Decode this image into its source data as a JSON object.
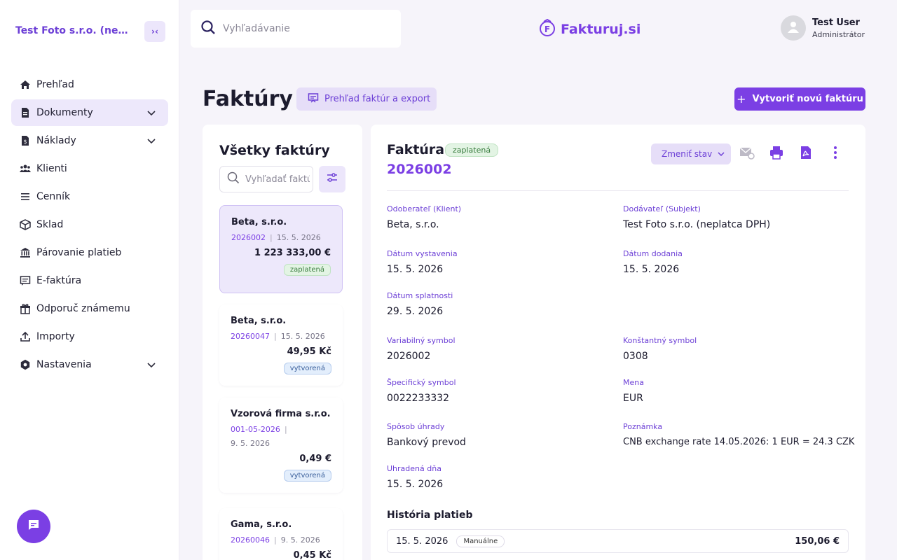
{
  "sidebar": {
    "company": "Test Foto s.r.o. (neplatca DPH)",
    "collapse_icon": "›‹",
    "items": [
      {
        "label": "Prehľad",
        "icon": "home-icon"
      },
      {
        "label": "Dokumenty",
        "icon": "document-icon",
        "active": true,
        "expandable": true
      },
      {
        "label": "Náklady",
        "icon": "receipt-icon",
        "expandable": true
      },
      {
        "label": "Klienti",
        "icon": "users-icon"
      },
      {
        "label": "Cenník",
        "icon": "list-icon"
      },
      {
        "label": "Sklad",
        "icon": "box-icon"
      },
      {
        "label": "Párovanie platieb",
        "icon": "bank-icon"
      },
      {
        "label": "E-faktúra",
        "icon": "message-icon"
      },
      {
        "label": "Odporuč známemu",
        "icon": "gift-icon"
      },
      {
        "label": "Importy",
        "icon": "upload-icon"
      },
      {
        "label": "Nastavenia",
        "icon": "gear-icon",
        "expandable": true
      }
    ]
  },
  "header": {
    "search_placeholder": "Vyhľadávanie",
    "logo_text": "Fakturuj.si",
    "user_name": "Test User",
    "user_role": "Administrátor"
  },
  "page": {
    "title": "Faktúry",
    "overview_button": "Prehľad faktúr a export",
    "create_button": "Vytvoriť novú faktúru"
  },
  "list": {
    "title": "Všetky faktúry",
    "search_placeholder": "Vyhľadať faktúru",
    "items": [
      {
        "client": "Beta, s.r.o.",
        "number": "2026002",
        "date": "15. 5. 2026",
        "amount": "1 223 333,00 €",
        "status": "zaplatená"
      },
      {
        "client": "Beta, s.r.o.",
        "number": "20260047",
        "date": "15. 5. 2026",
        "amount": "49,95 Kč",
        "status": "vytvorená"
      },
      {
        "client": "Vzorová firma s.r.o.",
        "number": "001-05-2026",
        "date": "9. 5. 2026",
        "amount": "0,49 €",
        "status": "vytvorená"
      },
      {
        "client": "Gama, s.r.o.",
        "number": "20260046",
        "date": "9. 5. 2026",
        "amount": "0,45 Kč",
        "status": ""
      }
    ]
  },
  "detail": {
    "title": "Faktúra",
    "status": "zaplatená",
    "number": "2026002",
    "change_state": "Zmeniť stav",
    "fields": [
      {
        "label": "Odoberateľ (Klient)",
        "value": "Beta, s.r.o."
      },
      {
        "label": "Dodávateľ (Subjekt)",
        "value": "Test Foto s.r.o. (neplatca DPH)"
      },
      {
        "label": "Dátum vystavenia",
        "value": "15. 5. 2026"
      },
      {
        "label": "Dátum dodania",
        "value": "15. 5. 2026"
      },
      {
        "label": "Dátum splatnosti",
        "value": "29. 5. 2026"
      },
      {
        "label": "Variabilný symbol",
        "value": "2026002"
      },
      {
        "label": "Konštantný symbol",
        "value": "0308"
      },
      {
        "label": "Špecifický symbol",
        "value": "0022233332"
      },
      {
        "label": "Mena",
        "value": "EUR"
      },
      {
        "label": "Spôsob úhrady",
        "value": "Bankový prevod"
      },
      {
        "label": "Poznámka",
        "value": "CNB exchange rate 14.05.2026: 1 EUR = 24.3 CZK"
      },
      {
        "label": "Uhradená dňa",
        "value": "15. 5. 2026"
      }
    ],
    "history_title": "História platieb",
    "history": [
      {
        "date": "15. 5. 2026",
        "tag": "Manuálne",
        "amount": "150,06 €"
      }
    ]
  },
  "colors": {
    "accent": "#7b3fe4",
    "accent_light": "#ede8fb",
    "paid": "#3a7d3f",
    "created": "#3a5f9b"
  }
}
